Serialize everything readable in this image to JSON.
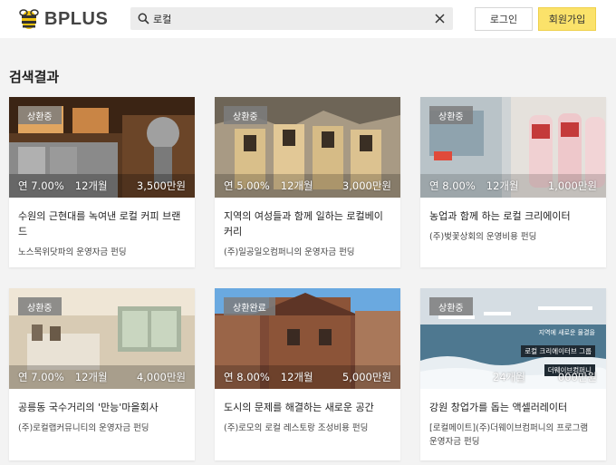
{
  "header": {
    "logo_text": "BPLUS",
    "search": {
      "value": "로컬",
      "placeholder": ""
    },
    "login_label": "로그인",
    "signup_label": "회원가입"
  },
  "page_title": "검색결과",
  "colors": {
    "accent": "#fbe26a",
    "badge": "#7d7d7d"
  },
  "cards": [
    {
      "badge": "상환중",
      "rate": "연 7.00%",
      "period": "12개월",
      "amount": "3,500만원",
      "title": "수원의 근현대를 녹여낸 로컬 커피 브랜드",
      "subtitle": "노스목위닷파의 운영자금 펀딩",
      "image": "cafe-interior"
    },
    {
      "badge": "상환중",
      "rate": "연 5.00%",
      "period": "12개월",
      "amount": "3,000만원",
      "title": "지역의 여성들과 함께 일하는 로컬베이커리",
      "subtitle": "(주)일공일오컴퍼니의 운영자금 펀딩",
      "image": "bakery-bags"
    },
    {
      "badge": "상환중",
      "rate": "연 8.00%",
      "period": "12개월",
      "amount": "1,000만원",
      "title": "농업과 함께 하는 로컬 크리에이터",
      "subtitle": "(주)벚꽃상회의 운영비용 펀딩",
      "image": "milk-bottles"
    },
    {
      "badge": "상환중",
      "rate": "연 7.00%",
      "period": "12개월",
      "amount": "4,000만원",
      "title": "공릉동 국수거리의 '만능'마을회사",
      "subtitle": "(주)로컬랩커뮤니티의 운영자금 펀딩",
      "image": "community-room"
    },
    {
      "badge": "상환완료",
      "rate": "연 8.00%",
      "period": "12개월",
      "amount": "5,000만원",
      "title": "도시의 문제를 해결하는 새로운 공간",
      "subtitle": "(주)로모의 로컬 레스토랑 조성비용 펀딩",
      "image": "brick-building"
    },
    {
      "badge": "상환중",
      "rate": "",
      "period": "24개월",
      "amount": "000만원",
      "title": "강원 창업가를 돕는 액셀러레이터",
      "subtitle": "[로컬메이트](주)더웨이브컴퍼니의 프로그램 운영자금 펀딩",
      "image": "ocean-waves",
      "overlay_lines": [
        "지역에 새로운 물결을",
        "로컬 크리에이터브 그룹",
        "더웨이브컴퍼니"
      ]
    }
  ]
}
